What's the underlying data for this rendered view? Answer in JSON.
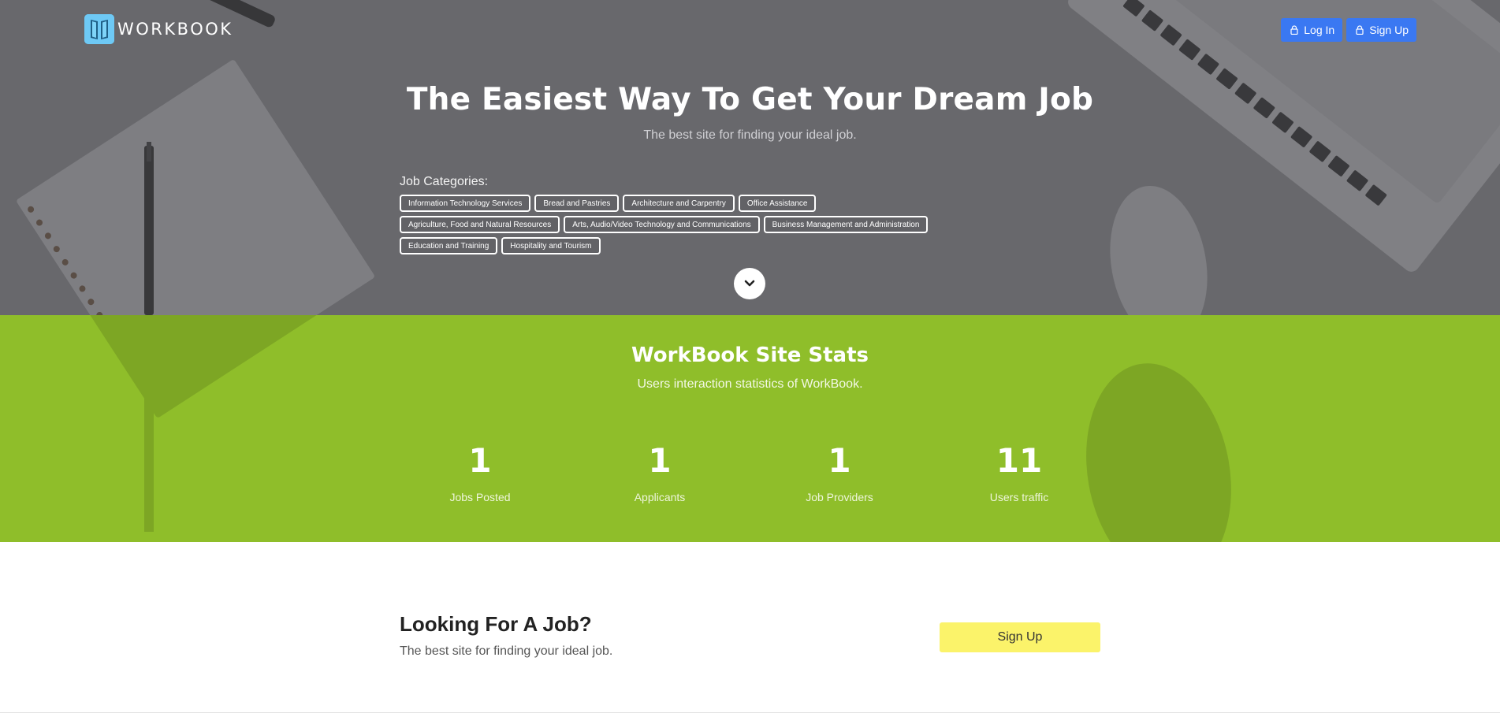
{
  "brand": {
    "name": "WORKBOOK"
  },
  "nav": {
    "login_label": "Log In",
    "signup_label": "Sign Up"
  },
  "hero": {
    "title": "The Easiest Way To Get Your Dream Job",
    "subtitle": "The best site for finding your ideal job.",
    "categories_label": "Job Categories:",
    "categories": [
      "Information Technology Services",
      "Bread and Pastries",
      "Architecture and Carpentry",
      "Office Assistance",
      "Agriculture, Food and Natural Resources",
      "Arts, Audio/Video Technology and Communications",
      "Business Management and Administration",
      "Education and Training",
      "Hospitality and Tourism"
    ],
    "scroll_icon": "chevron-down-icon"
  },
  "stats": {
    "title": "WorkBook Site Stats",
    "subtitle": "Users interaction statistics of WorkBook.",
    "items": [
      {
        "value": "1",
        "label": "Jobs Posted"
      },
      {
        "value": "1",
        "label": "Applicants"
      },
      {
        "value": "1",
        "label": "Job Providers"
      },
      {
        "value": "11",
        "label": "Users traffic"
      }
    ]
  },
  "cta": {
    "title": "Looking For A Job?",
    "subtitle": "The best site for finding your ideal job.",
    "button_label": "Sign Up"
  },
  "colors": {
    "nav_button": "#3a78f2",
    "stats_bg": "#8fbe2a",
    "cta_button": "#fbf36a"
  }
}
